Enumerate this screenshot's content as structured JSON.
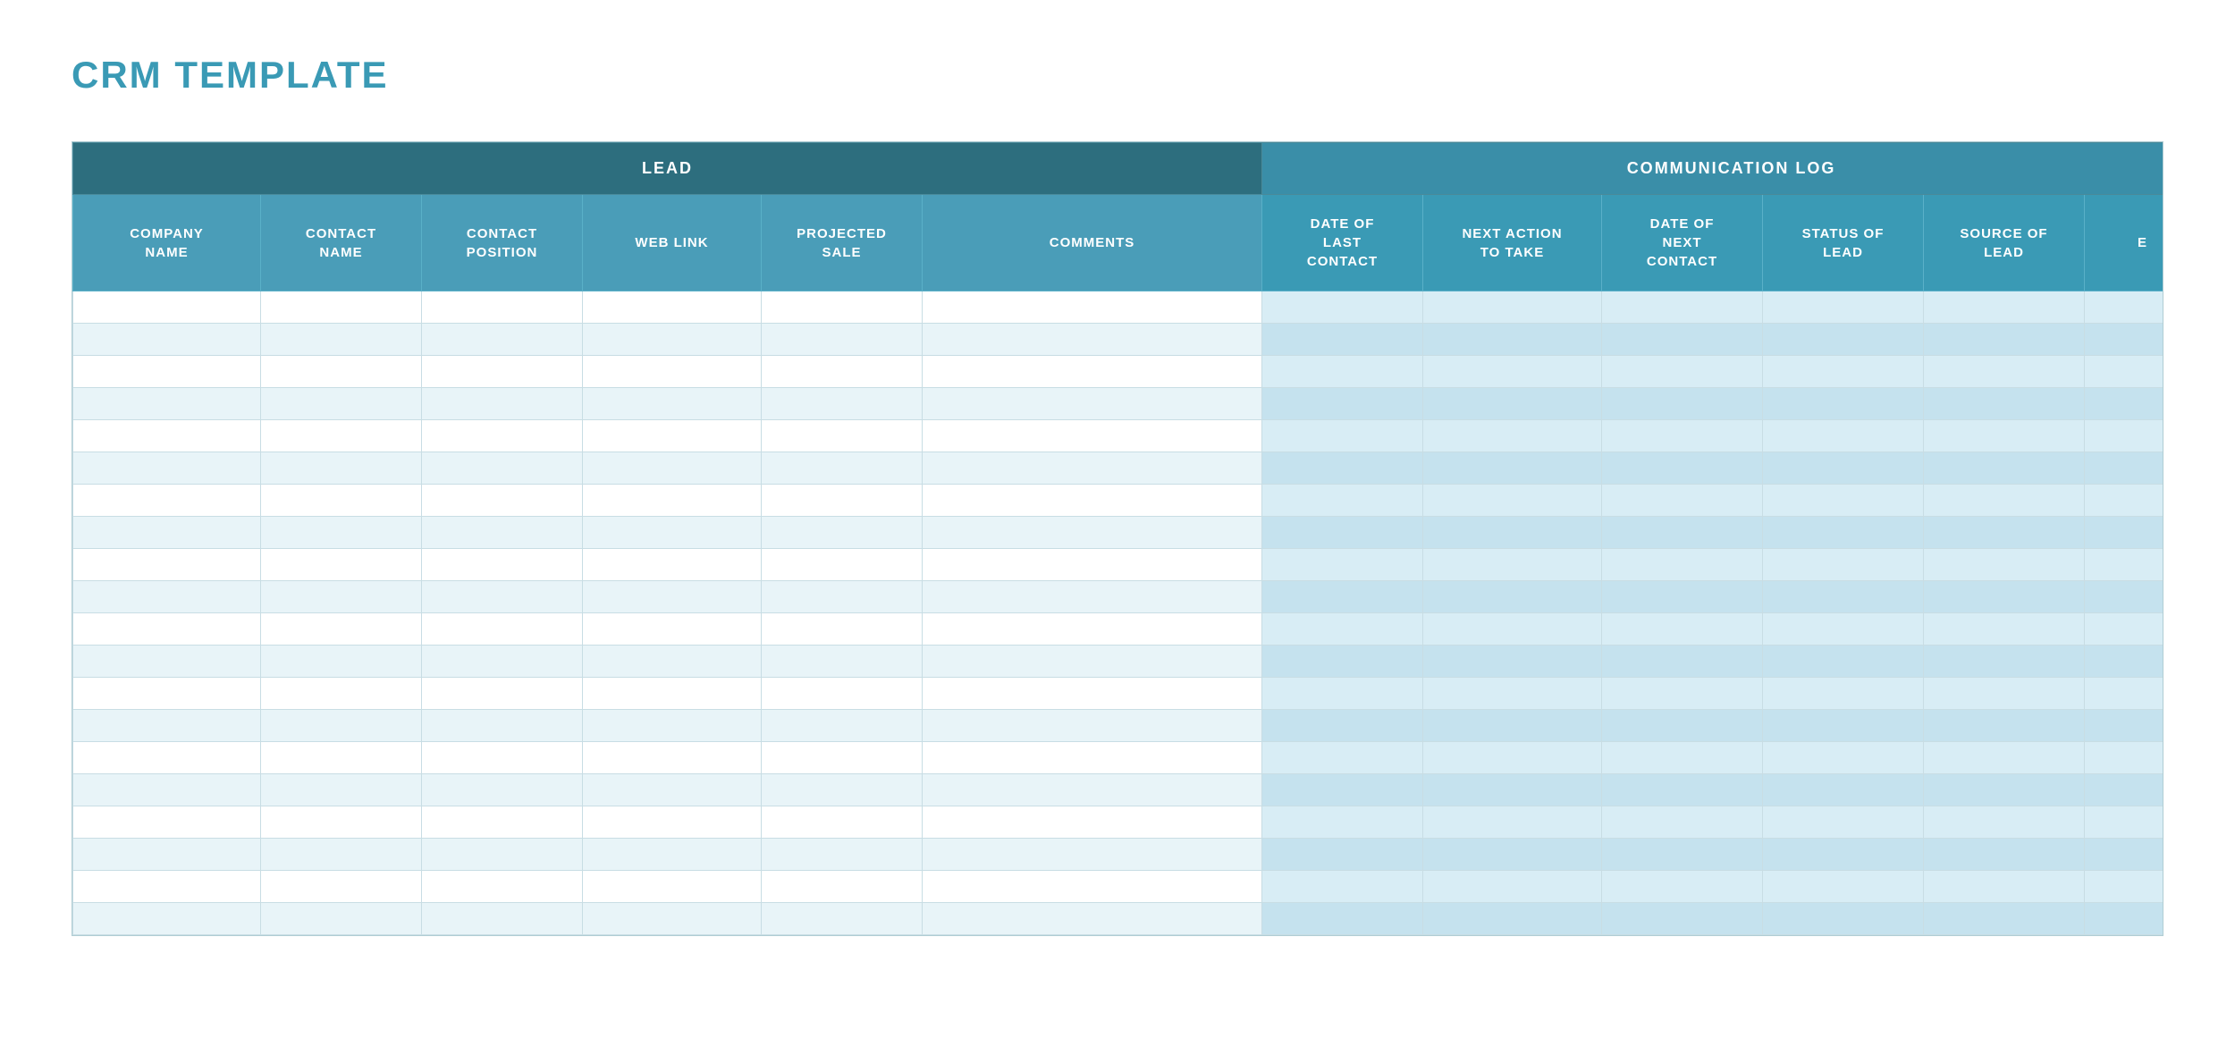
{
  "title": "CRM TEMPLATE",
  "sections": {
    "lead": {
      "label": "LEAD",
      "colspan": 6
    },
    "commlog": {
      "label": "COMMUNICATION LOG",
      "colspan": 6
    }
  },
  "columns": {
    "lead": [
      {
        "id": "company-name",
        "label": "COMPANY\nNAME"
      },
      {
        "id": "contact-name",
        "label": "CONTACT\nNAME"
      },
      {
        "id": "contact-position",
        "label": "CONTACT\nPOSITION"
      },
      {
        "id": "web-link",
        "label": "WEB LINK"
      },
      {
        "id": "projected-sale",
        "label": "PROJECTED\nSALE"
      },
      {
        "id": "comments",
        "label": "COMMENTS"
      }
    ],
    "comm": [
      {
        "id": "date-last-contact",
        "label": "DATE OF\nLAST\nCONTACT"
      },
      {
        "id": "next-action",
        "label": "NEXT ACTION\nTO TAKE"
      },
      {
        "id": "date-next-contact",
        "label": "DATE OF\nNEXT\nCONTACT"
      },
      {
        "id": "status-of-lead",
        "label": "STATUS OF\nLEAD"
      },
      {
        "id": "source-of-lead",
        "label": "SOURCE OF\nLEAD"
      },
      {
        "id": "extra",
        "label": "E"
      }
    ]
  },
  "row_count": 20
}
